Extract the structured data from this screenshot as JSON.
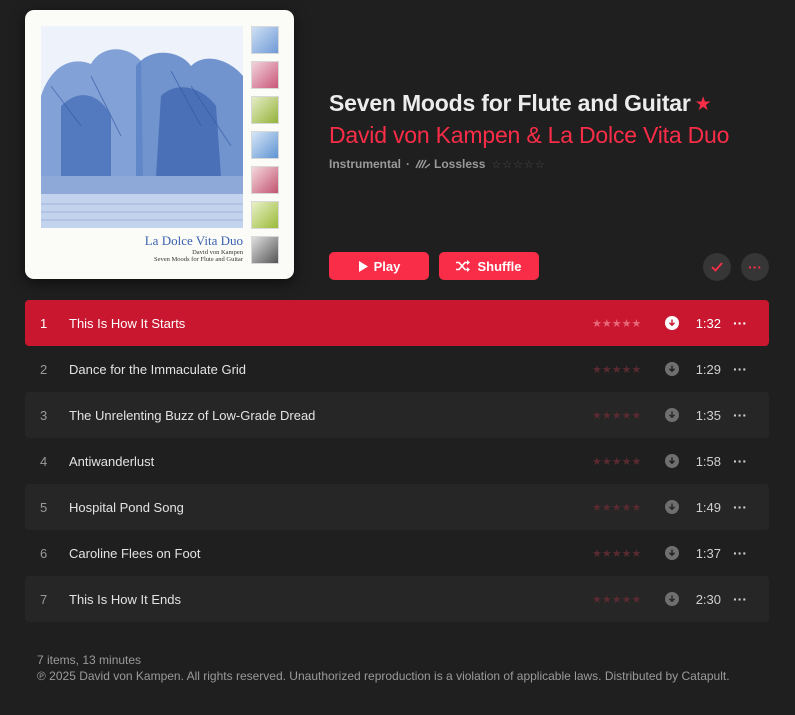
{
  "album": {
    "title": "Seven Moods for Flute and Guitar",
    "favorite_icon": "star-icon",
    "artist": "David von Kampen & La Dolce Vita Duo",
    "genre": "Instrumental",
    "separator": "·",
    "quality": "Lossless",
    "rating_stars": "☆☆☆☆☆",
    "accent_color": "#fa2d48"
  },
  "cover": {
    "title": "La Dolce Vita Duo",
    "line1": "David von Kampen",
    "line2": "Seven Moods for Flute and Guitar"
  },
  "actions": {
    "play_label": "Play",
    "shuffle_label": "Shuffle",
    "check_icon": "checkmark-icon",
    "more_label": "···"
  },
  "tracks": [
    {
      "num": "1",
      "title": "This Is How It Starts",
      "duration": "1:32",
      "stars": "★★★★★",
      "more": "···"
    },
    {
      "num": "2",
      "title": "Dance for the Immaculate Grid",
      "duration": "1:29",
      "stars": "★★★★★",
      "more": "···"
    },
    {
      "num": "3",
      "title": "The Unrelenting Buzz of Low-Grade Dread",
      "duration": "1:35",
      "stars": "★★★★★",
      "more": "···"
    },
    {
      "num": "4",
      "title": "Antiwanderlust",
      "duration": "1:58",
      "stars": "★★★★★",
      "more": "···"
    },
    {
      "num": "5",
      "title": "Hospital Pond Song",
      "duration": "1:49",
      "stars": "★★★★★",
      "more": "···"
    },
    {
      "num": "6",
      "title": "Caroline Flees on Foot",
      "duration": "1:37",
      "stars": "★★★★★",
      "more": "···"
    },
    {
      "num": "7",
      "title": "This Is How It Ends",
      "duration": "2:30",
      "stars": "★★★★★",
      "more": "···"
    }
  ],
  "footer": {
    "summary": "7 items, 13 minutes",
    "copyright": "℗ 2025 David von Kampen. All rights reserved. Unauthorized reproduction is a violation of applicable laws. Distributed by Catapult."
  }
}
